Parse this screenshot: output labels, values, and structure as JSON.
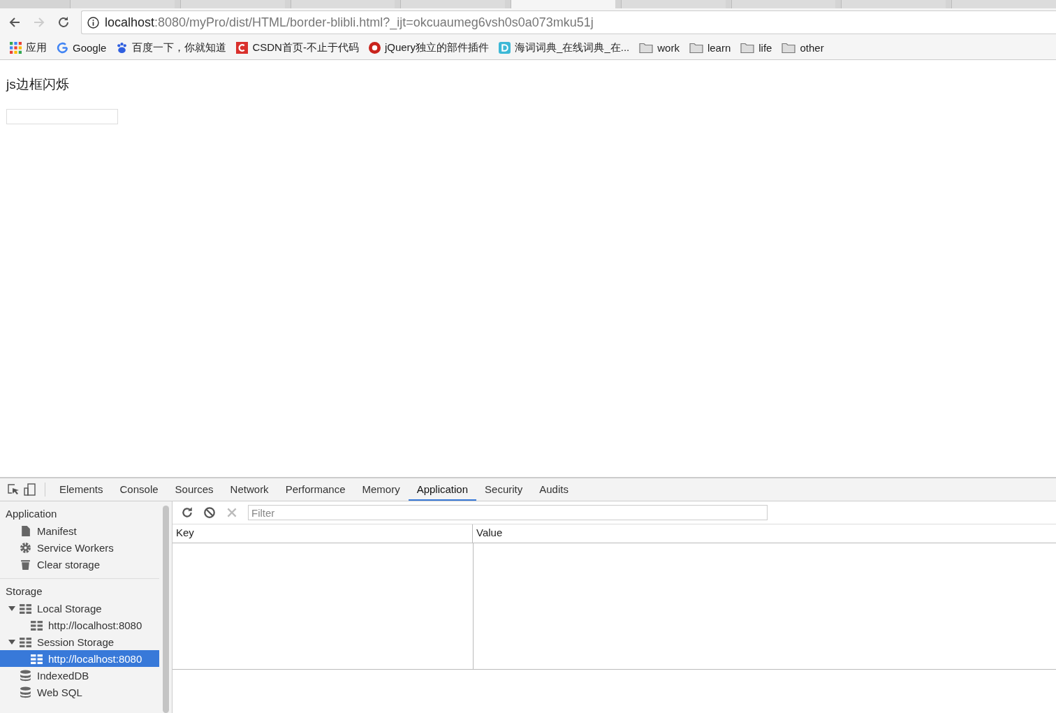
{
  "browser": {
    "tabs": [
      {
        "selected": false
      },
      {
        "selected": false
      },
      {
        "selected": false
      },
      {
        "selected": false
      },
      {
        "selected": true
      },
      {
        "selected": false
      },
      {
        "selected": false
      },
      {
        "selected": false
      },
      {
        "selected": false
      }
    ],
    "address": {
      "host": "localhost",
      "rest": ":8080/myPro/dist/HTML/border-blibli.html?_ijt=okcuaumeg6vsh0s0a073mku51j"
    },
    "bookmarks": [
      {
        "kind": "apps",
        "label": "应用"
      },
      {
        "kind": "google",
        "label": "Google"
      },
      {
        "kind": "baidu",
        "label": "百度一下，你就知道"
      },
      {
        "kind": "csdn",
        "label": "CSDN首页-不止于代码"
      },
      {
        "kind": "jquery",
        "label": "jQuery独立的部件插件"
      },
      {
        "kind": "dict",
        "label": "海词词典_在线词典_在..."
      },
      {
        "kind": "folder",
        "label": "work"
      },
      {
        "kind": "folder",
        "label": "learn"
      },
      {
        "kind": "folder",
        "label": "life"
      },
      {
        "kind": "folder",
        "label": "other"
      }
    ]
  },
  "page": {
    "heading": "js边框闪烁"
  },
  "devtools": {
    "tabs": [
      {
        "label": "Elements",
        "selected": false
      },
      {
        "label": "Console",
        "selected": false
      },
      {
        "label": "Sources",
        "selected": false
      },
      {
        "label": "Network",
        "selected": false
      },
      {
        "label": "Performance",
        "selected": false
      },
      {
        "label": "Memory",
        "selected": false
      },
      {
        "label": "Application",
        "selected": true
      },
      {
        "label": "Security",
        "selected": false
      },
      {
        "label": "Audits",
        "selected": false
      }
    ],
    "sidebar": {
      "sections": [
        {
          "title": "Application",
          "items": [
            {
              "kind": "file",
              "label": "Manifest",
              "selected": false
            },
            {
              "kind": "gear",
              "label": "Service Workers",
              "selected": false
            },
            {
              "kind": "trash",
              "label": "Clear storage",
              "selected": false
            }
          ]
        },
        {
          "title": "Storage",
          "items": [
            {
              "kind": "grid",
              "label": "Local Storage",
              "selected": false,
              "expanded": true,
              "children": [
                {
                  "label": "http://localhost:8080",
                  "selected": false
                }
              ]
            },
            {
              "kind": "grid",
              "label": "Session Storage",
              "selected": false,
              "expanded": true,
              "children": [
                {
                  "label": "http://localhost:8080",
                  "selected": true
                }
              ]
            },
            {
              "kind": "database",
              "label": "IndexedDB",
              "selected": false
            },
            {
              "kind": "database",
              "label": "Web SQL",
              "selected": false
            }
          ]
        }
      ]
    },
    "filter": {
      "placeholder": "Filter"
    },
    "table": {
      "columns": [
        "Key",
        "Value"
      ]
    }
  }
}
